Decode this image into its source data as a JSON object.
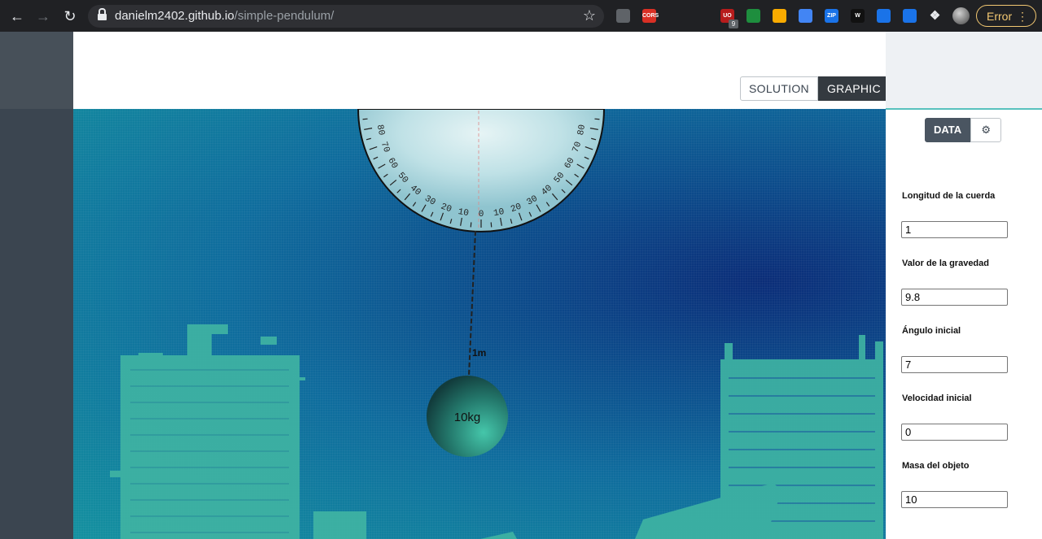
{
  "browser": {
    "url_host": "danielm2402.github.io",
    "url_path": "/simple-pendulum/",
    "error_label": "Error",
    "extension_badge": "9",
    "extensions": [
      {
        "icon": "vuejs-devtools-icon",
        "color": "#5f6368",
        "text": ""
      },
      {
        "icon": "cors-extension-icon",
        "color": "#d93025",
        "text": "CORS"
      },
      {
        "icon": "react-devtools-icon",
        "color": "#202124",
        "text": ""
      },
      {
        "icon": "target-extension-icon",
        "color": "#202124",
        "text": ""
      },
      {
        "icon": "ublock-icon",
        "color": "#b71c1c",
        "text": "UO"
      },
      {
        "icon": "screenshot-extension-icon",
        "color": "#1e8e3e",
        "text": ""
      },
      {
        "icon": "ghost-extension-icon",
        "color": "#f9ab00",
        "text": ""
      },
      {
        "icon": "square-extension-icon",
        "color": "#4285f4",
        "text": ""
      },
      {
        "icon": "zip-extension-icon",
        "color": "#1a73e8",
        "text": "ZIP"
      },
      {
        "icon": "w-extension-icon",
        "color": "#111111",
        "text": "W"
      },
      {
        "icon": "circle-extension-icon",
        "color": "#1a73e8",
        "text": ""
      },
      {
        "icon": "infinity-extension-icon",
        "color": "#1a73e8",
        "text": ""
      }
    ]
  },
  "tabs": {
    "solution": "SOLUTION",
    "graphic": "GRAPHIC"
  },
  "simulation": {
    "length_label": "1m",
    "mass_label": "10kg",
    "protractor_ticks_left": [
      "80",
      "70",
      "60",
      "50",
      "40",
      "30",
      "20",
      "10"
    ],
    "protractor_center": "0",
    "protractor_ticks_right": [
      "10",
      "20",
      "30",
      "40",
      "50",
      "60",
      "70",
      "80"
    ],
    "colors": {
      "building": "#3fb3a3",
      "bob": "#2f9a86",
      "protractor": "#b7dde3"
    }
  },
  "panel": {
    "data_tab": "DATA",
    "settings_icon": "gear-icon",
    "fields": [
      {
        "label": "Longitud de la cuerda",
        "value": "1"
      },
      {
        "label": "Valor de la gravedad",
        "value": "9.8"
      },
      {
        "label": "Ángulo inicial",
        "value": "7"
      },
      {
        "label": "Velocidad inicial",
        "value": "0"
      },
      {
        "label": "Masa del objeto",
        "value": "10"
      }
    ]
  }
}
